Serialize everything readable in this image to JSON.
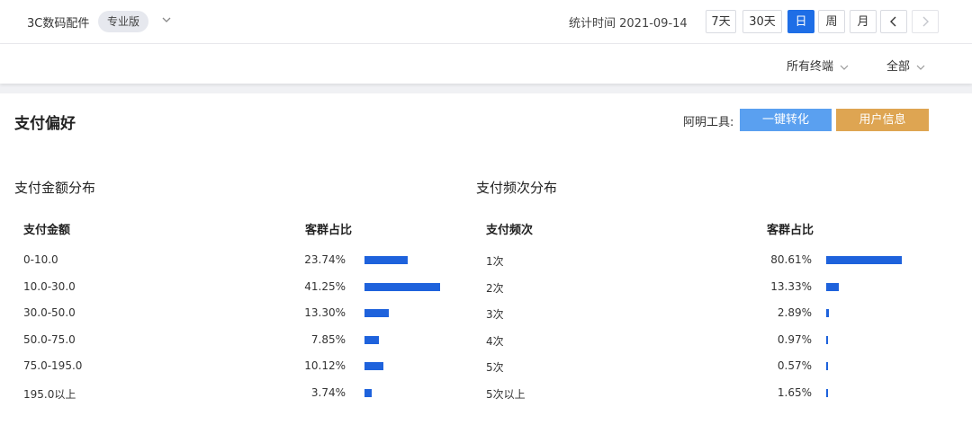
{
  "header": {
    "brand": "3C数码配件",
    "edition": "专业版",
    "stat_label": "统计时间 2021-09-14",
    "range_buttons": [
      "7天",
      "30天",
      "日",
      "周",
      "月"
    ],
    "active_range": "日"
  },
  "filters": {
    "terminal": "所有终端",
    "scope": "全部"
  },
  "panel": {
    "title": "支付偏好",
    "tools_label": "阿明工具:",
    "btn_convert": "一键转化",
    "btn_userinfo": "用户信息"
  },
  "amount": {
    "title": "支付金额分布",
    "col1": "支付金额",
    "col2": "客群占比",
    "rows": [
      {
        "label": "0-10.0",
        "pct": "23.74%",
        "value": 23.74
      },
      {
        "label": "10.0-30.0",
        "pct": "41.25%",
        "value": 41.25
      },
      {
        "label": "30.0-50.0",
        "pct": "13.30%",
        "value": 13.3
      },
      {
        "label": "50.0-75.0",
        "pct": "7.85%",
        "value": 7.85
      },
      {
        "label": "75.0-195.0",
        "pct": "10.12%",
        "value": 10.12
      },
      {
        "label": "195.0以上",
        "pct": "3.74%",
        "value": 3.74
      }
    ]
  },
  "frequency": {
    "title": "支付频次分布",
    "col1": "支付频次",
    "col2": "客群占比",
    "rows": [
      {
        "label": "1次",
        "pct": "80.61%",
        "value": 80.61
      },
      {
        "label": "2次",
        "pct": "13.33%",
        "value": 13.33
      },
      {
        "label": "3次",
        "pct": "2.89%",
        "value": 2.89
      },
      {
        "label": "4次",
        "pct": "0.97%",
        "value": 0.97
      },
      {
        "label": "5次",
        "pct": "0.57%",
        "value": 0.57
      },
      {
        "label": "5次以上",
        "pct": "1.65%",
        "value": 1.65
      }
    ]
  },
  "colors": {
    "accent": "#1e6ee6",
    "bar": "#1e62dc",
    "convert_button": "#5aa0f0",
    "userinfo_button": "#dea552"
  },
  "icons": [
    "chevron-down-icon",
    "chevron-left-icon",
    "chevron-right-icon"
  ]
}
